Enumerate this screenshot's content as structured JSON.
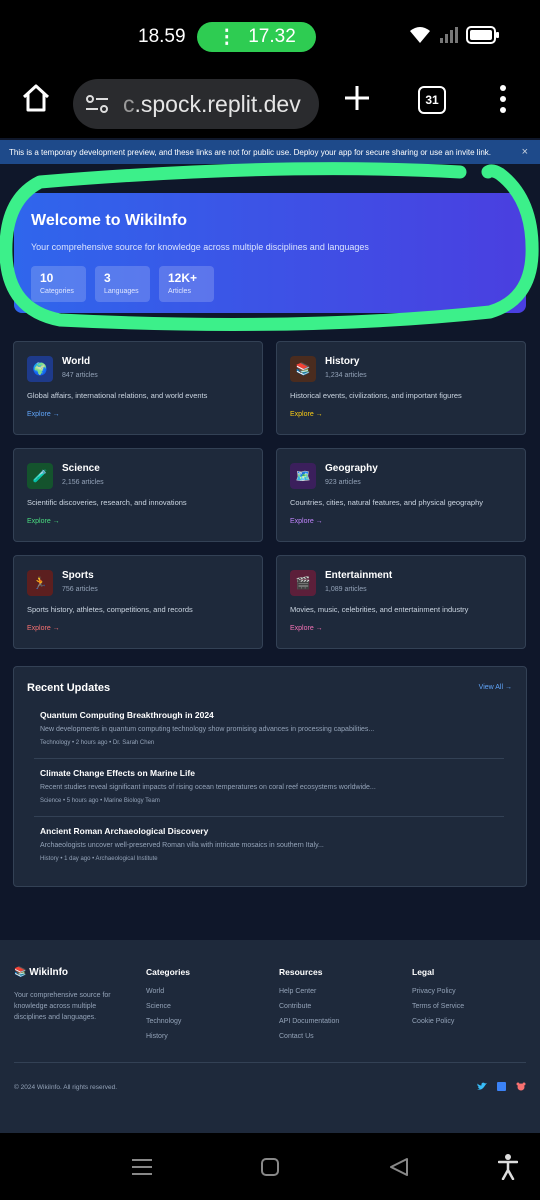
{
  "status_bar": {
    "time": "18.59",
    "call_time": "17.32"
  },
  "browser": {
    "url_dim": "c",
    "url_main": ".spock.replit.dev",
    "tab_count": "31"
  },
  "banner": {
    "text": "This is a temporary development preview, and these links are not for public use. Deploy your app for secure sharing or use an invite link.",
    "close": "×"
  },
  "hero": {
    "title": "Welcome to WikiInfo",
    "subtitle": "Your comprehensive source for knowledge across multiple disciplines and languages",
    "stats": [
      {
        "value": "10",
        "label": "Categories"
      },
      {
        "value": "3",
        "label": "Languages"
      },
      {
        "value": "12K+",
        "label": "Articles"
      }
    ]
  },
  "categories": [
    {
      "name": "World",
      "count": "847 articles",
      "desc": "Global affairs, international relations, and world events",
      "explore": "Explore →",
      "icon": "globe-icon",
      "glyph": "🌍",
      "accent": "#60a5fa",
      "icon_bg": "#1e3a8a"
    },
    {
      "name": "History",
      "count": "1,234 articles",
      "desc": "Historical events, civilizations, and important figures",
      "explore": "Explore →",
      "icon": "books-icon",
      "glyph": "📚",
      "accent": "#facc15",
      "icon_bg": "#4a2c1f"
    },
    {
      "name": "Science",
      "count": "2,156 articles",
      "desc": "Scientific discoveries, research, and innovations",
      "explore": "Explore →",
      "icon": "test-tube-icon",
      "glyph": "🧪",
      "accent": "#4ade80",
      "icon_bg": "#14532d"
    },
    {
      "name": "Geography",
      "count": "923 articles",
      "desc": "Countries, cities, natural features, and physical geography",
      "explore": "Explore →",
      "icon": "map-icon",
      "glyph": "🗺️",
      "accent": "#c084fc",
      "icon_bg": "#3b1f5c"
    },
    {
      "name": "Sports",
      "count": "756 articles",
      "desc": "Sports history, athletes, competitions, and records",
      "explore": "Explore →",
      "icon": "runner-icon",
      "glyph": "🏃",
      "accent": "#f87171",
      "icon_bg": "#5c1f1f"
    },
    {
      "name": "Entertainment",
      "count": "1,089 articles",
      "desc": "Movies, music, celebrities, and entertainment industry",
      "explore": "Explore →",
      "icon": "clapperboard-icon",
      "glyph": "🎬",
      "accent": "#f472b6",
      "icon_bg": "#5c1f3a"
    }
  ],
  "updates": {
    "title": "Recent Updates",
    "view_all": "View All →",
    "items": [
      {
        "title": "Quantum Computing Breakthrough in 2024",
        "desc": "New developments in quantum computing technology show promising advances in processing capabilities...",
        "meta": "Technology  •  2 hours ago  •  Dr. Sarah Chen"
      },
      {
        "title": "Climate Change Effects on Marine Life",
        "desc": "Recent studies reveal significant impacts of rising ocean temperatures on coral reef ecosystems worldwide...",
        "meta": "Science  •  5 hours ago  •  Marine Biology Team"
      },
      {
        "title": "Ancient Roman Archaeological Discovery",
        "desc": "Archaeologists uncover well-preserved Roman villa with intricate mosaics in southern Italy...",
        "meta": "History  •  1 day ago  •  Archaeological Institute"
      }
    ]
  },
  "footer": {
    "brand": "📚 WikiInfo",
    "tagline": "Your comprehensive source for knowledge across multiple disciplines and languages.",
    "columns": [
      {
        "heading": "Categories",
        "links": [
          "World",
          "Science",
          "Technology",
          "History"
        ]
      },
      {
        "heading": "Resources",
        "links": [
          "Help Center",
          "Contribute",
          "API Documentation",
          "Contact Us"
        ]
      },
      {
        "heading": "Legal",
        "links": [
          "Privacy Policy",
          "Terms of Service",
          "Cookie Policy"
        ]
      }
    ],
    "copyright": "© 2024 WikiInfo. All rights reserved.",
    "social": [
      "twitter-icon",
      "facebook-icon",
      "github-icon"
    ]
  },
  "colors": {
    "page_bg": "#0f172a",
    "card_bg": "#1e293b",
    "highlight": "#3cf08a",
    "hero_gradient_start": "#2f66ec",
    "hero_gradient_end": "#4a3fe0"
  }
}
